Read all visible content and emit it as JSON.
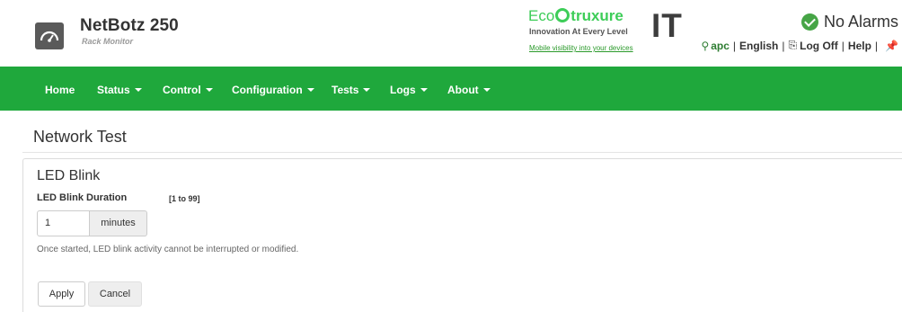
{
  "header": {
    "product_name": "NetBotz 250",
    "product_subtitle": "Rack Monitor",
    "eco_word_a": "Eco",
    "eco_word_b": "truxure",
    "eco_tagline": "Innovation At Every Level",
    "eco_link": "Mobile visibility into your devices",
    "eco_suffix": "IT",
    "alarm_status": "No Alarms",
    "user": "apc",
    "language": "English",
    "logoff": "Log Off",
    "help": "Help"
  },
  "nav": {
    "items": [
      {
        "label": "Home"
      },
      {
        "label": "Status"
      },
      {
        "label": "Control"
      },
      {
        "label": "Configuration"
      },
      {
        "label": "Tests"
      },
      {
        "label": "Logs"
      },
      {
        "label": "About"
      }
    ]
  },
  "page": {
    "title": "Network Test"
  },
  "led_blink": {
    "section_title": "LED Blink",
    "field_label": "LED Blink Duration",
    "field_range": "[1 to 99]",
    "input_value": "1",
    "input_unit": "minutes",
    "help_text": "Once started, LED blink activity cannot be interrupted or modified.",
    "apply_label": "Apply",
    "cancel_label": "Cancel"
  },
  "colors": {
    "nav_green": "#1fa83c",
    "brand_green": "#3dcd58",
    "ok_green": "#46a546"
  }
}
